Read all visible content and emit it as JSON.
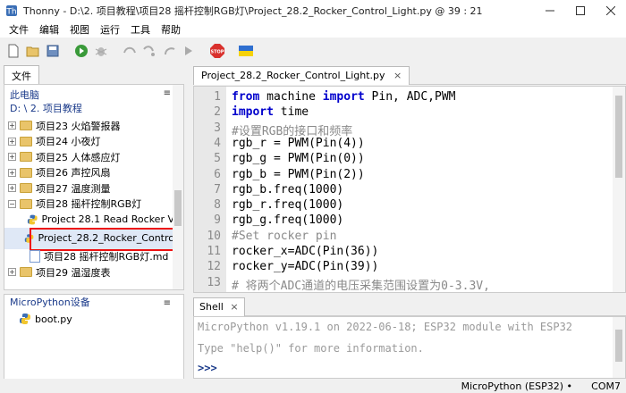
{
  "window": {
    "title": "Thonny  -  D:\\2. 项目教程\\项目28 摇杆控制RGB灯\\Project_28.2_Rocker_Control_Light.py  @  39 : 21"
  },
  "menu": [
    "文件",
    "编辑",
    "视图",
    "运行",
    "工具",
    "帮助"
  ],
  "toolbar": [
    "new-file",
    "open-file",
    "save",
    "run",
    "debug",
    "step-over",
    "step-into",
    "step-out",
    "resume",
    "stop",
    "ukraine-flag"
  ],
  "files_panel": {
    "tab": "文件",
    "location_title": "此电脑",
    "location_path": "D: \\ 2. 项目教程",
    "tree": [
      {
        "label": "项目23 火焰警报器",
        "type": "folder",
        "expander": "+"
      },
      {
        "label": "项目24 小夜灯",
        "type": "folder",
        "expander": "+"
      },
      {
        "label": "项目25 人体感应灯",
        "type": "folder",
        "expander": "+"
      },
      {
        "label": "项目26 声控风扇",
        "type": "folder",
        "expander": "+"
      },
      {
        "label": "项目27 温度测量",
        "type": "folder",
        "expander": "+"
      },
      {
        "label": "项目28 摇杆控制RGB灯",
        "type": "folder",
        "expander": "−"
      },
      {
        "label": "Project 28.1 Read Rocker V",
        "type": "py",
        "expander": ""
      },
      {
        "label": "Project_28.2_Rocker_Contro",
        "type": "py",
        "expander": "",
        "selected": true
      },
      {
        "label": "项目28 摇杆控制RGB灯.md",
        "type": "md",
        "expander": ""
      },
      {
        "label": "项目29 温湿度表",
        "type": "folder",
        "expander": "+"
      }
    ]
  },
  "device_panel": {
    "title": "MicroPython设备",
    "files": [
      "boot.py"
    ]
  },
  "editor": {
    "tab": "Project_28.2_Rocker_Control_Light.py",
    "lines": [
      [
        [
          "kw",
          "from"
        ],
        [
          "t",
          " machine "
        ],
        [
          "kw",
          "import"
        ],
        [
          "t",
          " Pin, ADC,PWM"
        ]
      ],
      [
        [
          "kw",
          "import"
        ],
        [
          "t",
          " time"
        ]
      ],
      [
        [
          "cm",
          "#设置RGB的接口和频率"
        ]
      ],
      [
        [
          "t",
          "rgb_r = PWM(Pin(4))"
        ]
      ],
      [
        [
          "t",
          "rgb_g = PWM(Pin(0))"
        ]
      ],
      [
        [
          "t",
          "rgb_b = PWM(Pin(2))"
        ]
      ],
      [
        [
          "t",
          "rgb_b.freq(1000)"
        ]
      ],
      [
        [
          "t",
          "rgb_r.freq(1000)"
        ]
      ],
      [
        [
          "t",
          "rgb_g.freq(1000)"
        ]
      ],
      [
        [
          "cm",
          "#Set rocker pin"
        ]
      ],
      [
        [
          "t",
          "rocker_x=ADC(Pin(36))"
        ]
      ],
      [
        [
          "t",
          "rocker_y=ADC(Pin(39))"
        ]
      ],
      [
        [
          "cm",
          "# 将两个ADC通道的电压采集范围设置为0-3.3V,"
        ]
      ]
    ]
  },
  "shell": {
    "tab": "Shell",
    "lines": [
      "MicroPython v1.19.1 on 2022-06-18; ESP32 module with ESP32",
      "Type \"help()\" for more information."
    ],
    "prompt": ">>>"
  },
  "status": {
    "interpreter": "MicroPython (ESP32)",
    "port": "COM7"
  }
}
